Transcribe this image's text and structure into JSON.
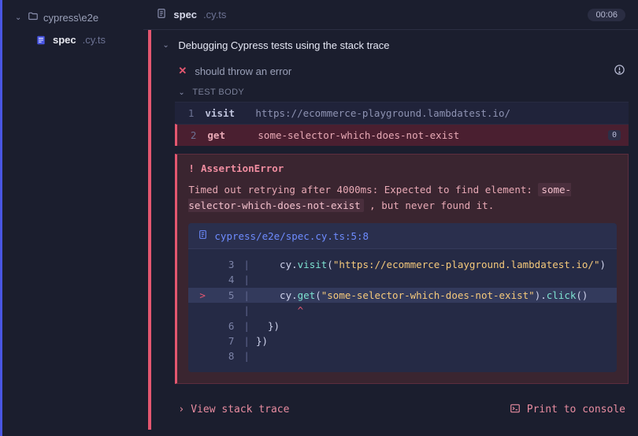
{
  "sidebar": {
    "folder": "cypress\\e2e",
    "file_base": "spec",
    "file_ext": ".cy.ts"
  },
  "tab": {
    "name": "spec",
    "ext": ".cy.ts",
    "timer": "00:06"
  },
  "suite": {
    "title": "Debugging Cypress tests using the stack trace",
    "test_title": "should throw an error",
    "body_label": "TEST BODY"
  },
  "commands": [
    {
      "n": "1",
      "name": "visit",
      "args": "https://ecommerce-playground.lambdatest.io/",
      "fail": false,
      "badge": ""
    },
    {
      "n": "2",
      "name": "get",
      "args": "some-selector-which-does-not-exist",
      "fail": true,
      "badge": "0"
    }
  ],
  "error": {
    "name": "AssertionError",
    "msg_prefix": "Timed out retrying after 4000ms: Expected to find element: ",
    "selector": "some-selector-which-does-not-exist",
    "msg_suffix": " , but never found it.",
    "file_loc": "cypress/e2e/spec.cy.ts:5:8"
  },
  "code": {
    "lines": [
      {
        "n": "3",
        "mark": "",
        "hl": false,
        "segments": [
          [
            "",
            "    "
          ],
          [
            "obj",
            "cy"
          ],
          [
            "dot",
            "."
          ],
          [
            "fn",
            "visit"
          ],
          [
            "pn",
            "("
          ],
          [
            "str",
            "\"https://ecommerce-playground.lambdatest.io/\""
          ],
          [
            "pn",
            ")"
          ]
        ]
      },
      {
        "n": "4",
        "mark": "",
        "hl": false,
        "segments": []
      },
      {
        "n": "5",
        "mark": ">",
        "hl": true,
        "segments": [
          [
            "",
            "    "
          ],
          [
            "obj",
            "cy"
          ],
          [
            "dot",
            "."
          ],
          [
            "fn",
            "get"
          ],
          [
            "pn",
            "("
          ],
          [
            "str",
            "\"some-selector-which-does-not-exist\""
          ],
          [
            "pn",
            ")"
          ],
          [
            "dot",
            "."
          ],
          [
            "fn",
            "click"
          ],
          [
            "pn",
            "()"
          ]
        ]
      },
      {
        "n": "",
        "mark": "",
        "hl": false,
        "segments": [
          [
            "caret",
            "       ^"
          ]
        ]
      },
      {
        "n": "6",
        "mark": "",
        "hl": false,
        "segments": [
          [
            "pn",
            "  })"
          ]
        ]
      },
      {
        "n": "7",
        "mark": "",
        "hl": false,
        "segments": [
          [
            "pn",
            "})"
          ]
        ]
      },
      {
        "n": "8",
        "mark": "",
        "hl": false,
        "segments": []
      }
    ]
  },
  "footer": {
    "view_stack": "View stack trace",
    "print_console": "Print to console"
  }
}
